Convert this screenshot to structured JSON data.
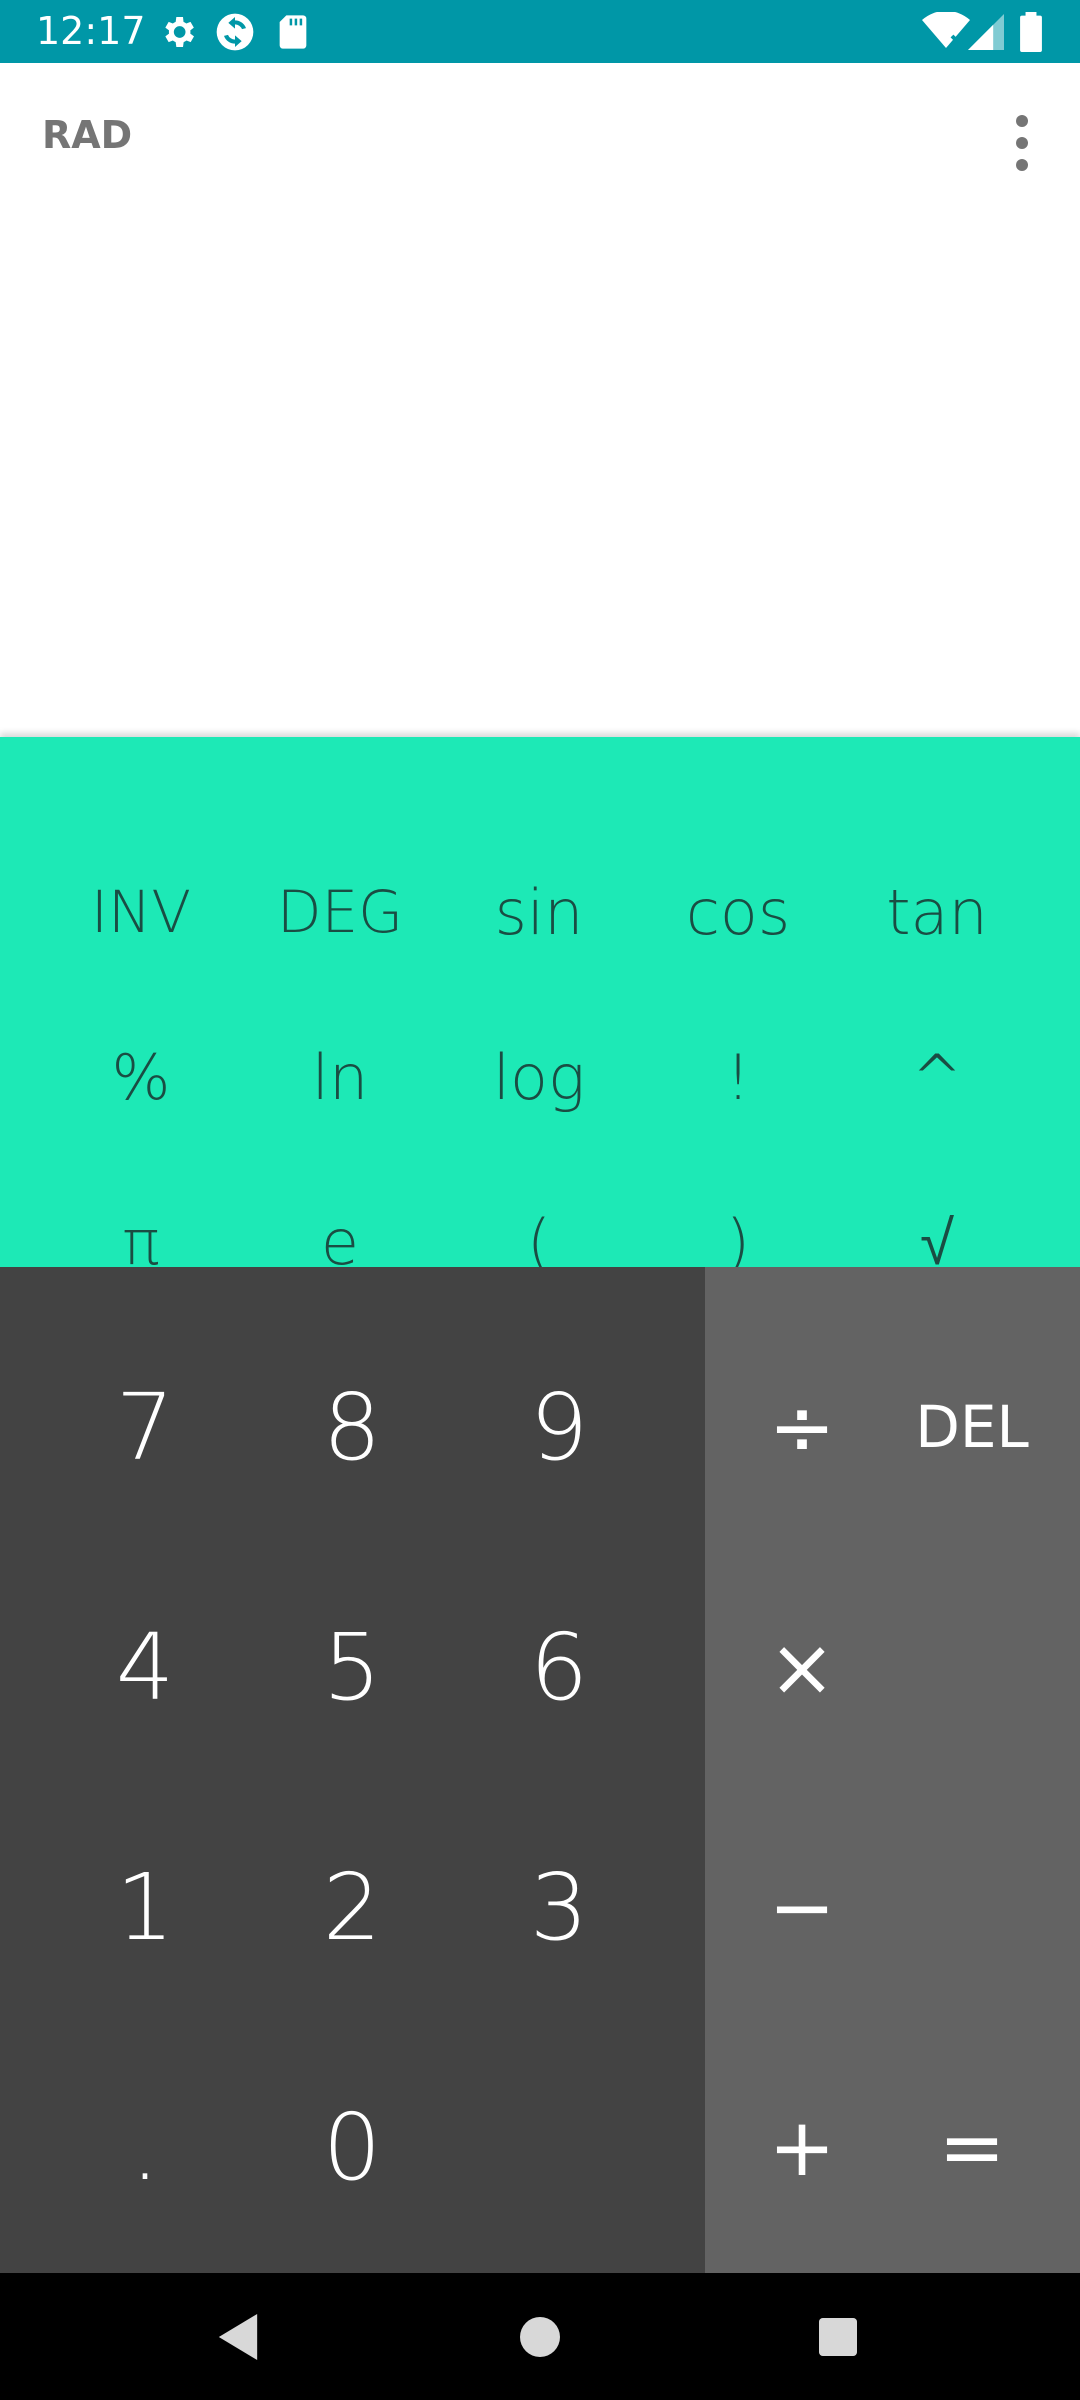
{
  "status_bar": {
    "time": "12:17",
    "icons": [
      "gear-icon",
      "sync-icon",
      "sd-card-icon",
      "wifi-icon",
      "signal-icon",
      "battery-icon"
    ]
  },
  "display": {
    "mode": "RAD",
    "overflow_icon": "more-vert-icon"
  },
  "advanced_keys": [
    [
      "INV",
      "DEG",
      "sin",
      "cos",
      "tan"
    ],
    [
      "%",
      "ln",
      "log",
      "!",
      "^"
    ],
    [
      "π",
      "e",
      "(",
      ")",
      "√"
    ]
  ],
  "numpad": {
    "row1": [
      "7",
      "8",
      "9"
    ],
    "row2": [
      "4",
      "5",
      "6"
    ],
    "row3": [
      "1",
      "2",
      "3"
    ],
    "row4": [
      ".",
      "0"
    ]
  },
  "operators": {
    "divide": "÷",
    "delete": "DEL",
    "multiply": "×",
    "minus": "−",
    "plus": "+",
    "equals": "="
  },
  "nav": [
    "back-icon",
    "home-icon",
    "recents-icon"
  ],
  "colors": {
    "status_bar": "#0097A7",
    "advanced_pad": "#1DE9B6",
    "numpad": "#434343",
    "operator_pad": "#636363"
  }
}
